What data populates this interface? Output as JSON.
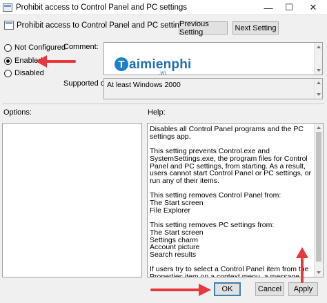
{
  "window": {
    "title": "Prohibit access to Control Panel and PC settings",
    "minimize": "—",
    "maximize": "☐",
    "close": "✕"
  },
  "header": {
    "title": "Prohibit access to Control Panel and PC settings",
    "prev_label": "Previous Setting",
    "next_label": "Next Setting"
  },
  "state": {
    "options": [
      {
        "label": "Not Configured",
        "checked": false
      },
      {
        "label": "Enabled",
        "checked": true
      },
      {
        "label": "Disabled",
        "checked": false
      }
    ]
  },
  "comment": {
    "label": "Comment:",
    "value": ""
  },
  "supported": {
    "label": "Supported on:",
    "value": "At least Windows 2000"
  },
  "watermark": {
    "mark": "T",
    "text": "aimienphi",
    "sub": ".vn"
  },
  "panes": {
    "options_label": "Options:",
    "help_label": "Help:",
    "help_paragraphs": [
      "Disables all Control Panel programs and the PC settings app.",
      "This setting prevents Control.exe and SystemSettings.exe, the program files for Control Panel and PC settings, from starting. As a result, users cannot start Control Panel or PC settings, or run any of their items.",
      "This setting removes Control Panel from:\nThe Start screen\nFile Explorer",
      "This setting removes PC settings from:\nThe Start screen\nSettings charm\nAccount picture\nSearch results",
      "If users try to select a Control Panel item from the Properties item on a context menu, a message appears explaining that a setting prevents the action."
    ]
  },
  "footer": {
    "ok_label": "OK",
    "cancel_label": "Cancel",
    "apply_label": "Apply"
  },
  "colors": {
    "annotation_arrow": "#e8383d",
    "watermark": "#1f6fb8"
  }
}
